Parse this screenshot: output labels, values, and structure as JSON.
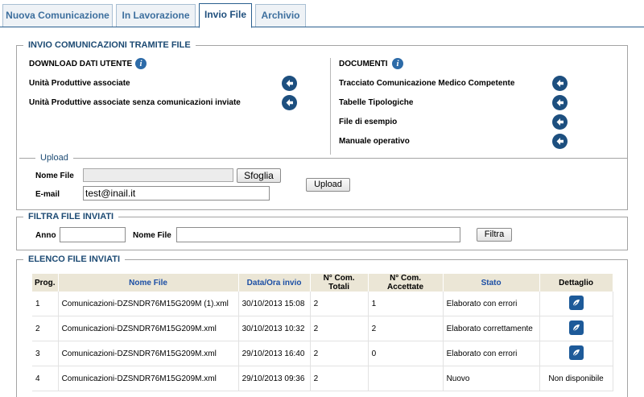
{
  "tabs": [
    {
      "label": "Nuova Comunicazione"
    },
    {
      "label": "In Lavorazione"
    },
    {
      "label": "Invio File"
    },
    {
      "label": "Archivio"
    }
  ],
  "invio": {
    "legend": "INVIO COMUNICAZIONI TRAMITE FILE",
    "download_header": "DOWNLOAD DATI UTENTE",
    "documenti_header": "DOCUMENTI",
    "download_items": [
      {
        "label": "Unità Produttive associate"
      },
      {
        "label": "Unità Produttive associate senza comunicazioni inviate"
      }
    ],
    "documenti_items": [
      {
        "label": "Tracciato Comunicazione Medico Competente"
      },
      {
        "label": "Tabelle Tipologiche"
      },
      {
        "label": "File di esempio"
      },
      {
        "label": "Manuale operativo"
      }
    ],
    "upload": {
      "legend": "Upload",
      "nome_file_label": "Nome File",
      "nome_file_value": "",
      "browse_label": "Sfoglia",
      "email_label": "E-mail",
      "email_value": "test@inail.it",
      "upload_button": "Upload"
    }
  },
  "filtra": {
    "legend": "FILTRA FILE INVIATI",
    "anno_label": "Anno",
    "anno_value": "",
    "nome_file_label": "Nome File",
    "nome_file_value": "",
    "filtra_button": "Filtra"
  },
  "elenco": {
    "legend": "ELENCO FILE INVIATI",
    "headers": {
      "prog": "Prog.",
      "nome_file": "Nome File",
      "data_ora": "Data/Ora invio",
      "com_totali": "N° Com. Totali",
      "com_accettate": "N° Com. Accettate",
      "stato": "Stato",
      "dettaglio": "Dettaglio"
    },
    "rows": [
      {
        "prog": "1",
        "nome_file": "Comunicazioni-DZSNDR76M15G209M (1).xml",
        "data_ora": "30/10/2013 15:08",
        "com_totali": "2",
        "com_accettate": "1",
        "stato": "Elaborato con errori",
        "dettaglio": ""
      },
      {
        "prog": "2",
        "nome_file": "Comunicazioni-DZSNDR76M15G209M.xml",
        "data_ora": "30/10/2013 10:32",
        "com_totali": "2",
        "com_accettate": "2",
        "stato": "Elaborato correttamente",
        "dettaglio": ""
      },
      {
        "prog": "3",
        "nome_file": "Comunicazioni-DZSNDR76M15G209M.xml",
        "data_ora": "29/10/2013 16:40",
        "com_totali": "2",
        "com_accettate": "0",
        "stato": "Elaborato con errori",
        "dettaglio": ""
      },
      {
        "prog": "4",
        "nome_file": "Comunicazioni-DZSNDR76M15G209M.xml",
        "data_ora": "29/10/2013 09:36",
        "com_totali": "2",
        "com_accettate": "",
        "stato": "Nuovo",
        "dettaglio": "Non disponibile"
      }
    ]
  }
}
